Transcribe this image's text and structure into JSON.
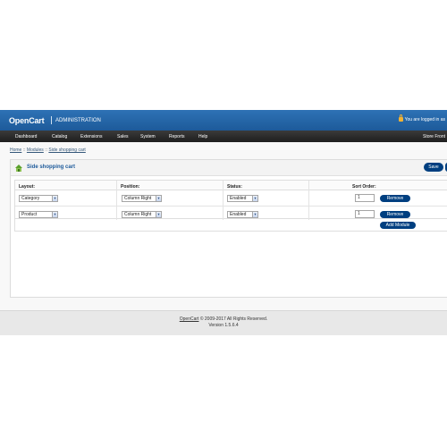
{
  "header": {
    "brand": "OpenCart",
    "subtitle": "ADMINISTRATION",
    "login_text": "You are logged in as"
  },
  "nav": {
    "items": [
      "Dashboard",
      "Catalog",
      "Extensions",
      "Sales",
      "System",
      "Reports",
      "Help"
    ],
    "store_front": "Store Front"
  },
  "breadcrumb": [
    "Home",
    "Modules",
    "Side shopping cart"
  ],
  "panel": {
    "title": "Side shopping cart",
    "save_label": "Save",
    "columns": [
      "Layout:",
      "Position:",
      "Status:",
      "Sort Order:"
    ],
    "rows": [
      {
        "layout": "Category",
        "position": "Column Right",
        "status": "Enabled",
        "sort_order": "1",
        "remove_label": "Remove"
      },
      {
        "layout": "Product",
        "position": "Column Right",
        "status": "Enabled",
        "sort_order": "1",
        "remove_label": "Remove"
      }
    ],
    "add_module_label": "Add Module"
  },
  "footer": {
    "brand_link": "OpenCart",
    "copyright": "© 2009-2017 All Rights Reserved.",
    "version": "Version 1.5.6.4"
  },
  "colors": {
    "header_blue": "#1d5a9a",
    "nav_dark": "#2a2a2a",
    "button_navy": "#003f80",
    "title_blue": "#1d5a9a"
  }
}
